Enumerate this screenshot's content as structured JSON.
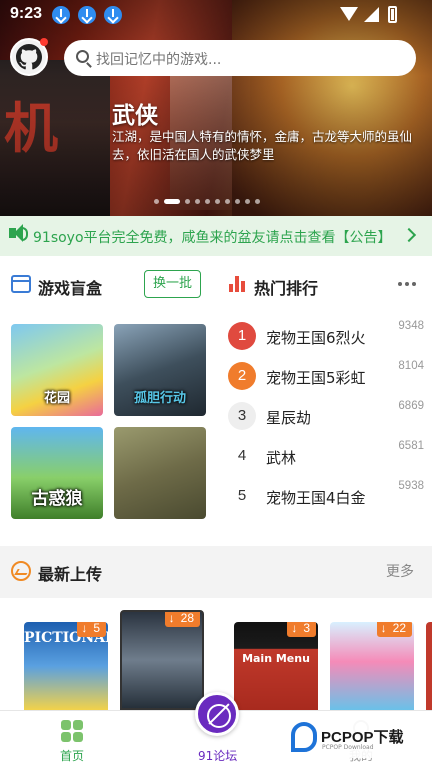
{
  "status_bar": {
    "time": "9:23"
  },
  "search": {
    "placeholder": "找回记忆中的游戏..."
  },
  "banner": {
    "title": "武侠",
    "description": "江湖，是中国人特有的情怀，金庸，古龙等大师的虽仙去，依旧活在国人的武侠梦里",
    "slide_count": 10,
    "active_slide": 1
  },
  "notice": {
    "text": "91soyo平台完全免费，咸鱼来的盆友请点击查看【公告】"
  },
  "blind_box": {
    "title": "游戏盲盒",
    "refresh_label": "换一批",
    "games": [
      {
        "label": "花园"
      },
      {
        "label": "孤胆行动"
      },
      {
        "label": "古惑狼"
      },
      {
        "label": ""
      }
    ]
  },
  "hot_rank": {
    "title": "热门排行",
    "items": [
      {
        "rank": "1",
        "name": "宠物王国6烈火",
        "count": "9348",
        "color": "#e04a3f"
      },
      {
        "rank": "2",
        "name": "宠物王国5彩虹",
        "count": "8104",
        "color": "#f07c2c"
      },
      {
        "rank": "3",
        "name": "星辰劫",
        "count": "6869",
        "color": "#eeeeee"
      },
      {
        "rank": "4",
        "name": "武林",
        "count": "6581",
        "color": ""
      },
      {
        "rank": "5",
        "name": "宠物王国4白金",
        "count": "5938",
        "color": ""
      }
    ]
  },
  "latest": {
    "title": "最新上传",
    "more_label": "更多",
    "items": [
      {
        "cover_text": "PICTIONARY",
        "downloads": "5"
      },
      {
        "cover_text": "",
        "downloads": "28"
      },
      {
        "cover_text": "Main Menu",
        "downloads": "3"
      },
      {
        "cover_text": "",
        "downloads": "22"
      }
    ]
  },
  "bottom_nav": {
    "home": "首页",
    "forum": "91论坛",
    "mine": "我的"
  },
  "watermark": {
    "brand": "PCPOP下载",
    "sub": "PCPOP Download"
  },
  "colors": {
    "accent": "#2da44e",
    "rank_red": "#e74c3c",
    "latest_orange": "#f08a24"
  }
}
